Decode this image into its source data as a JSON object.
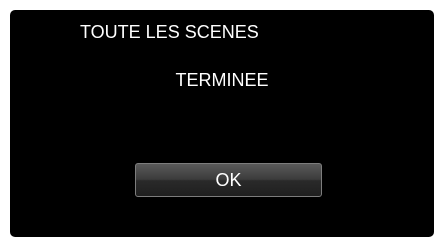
{
  "dialog": {
    "title": "TOUTE LES SCENES",
    "message": "TERMINEE",
    "ok_label": "OK"
  },
  "colors": {
    "screen_background": "#000000",
    "text": "#ffffff",
    "button_border": "#7d7d7d"
  }
}
